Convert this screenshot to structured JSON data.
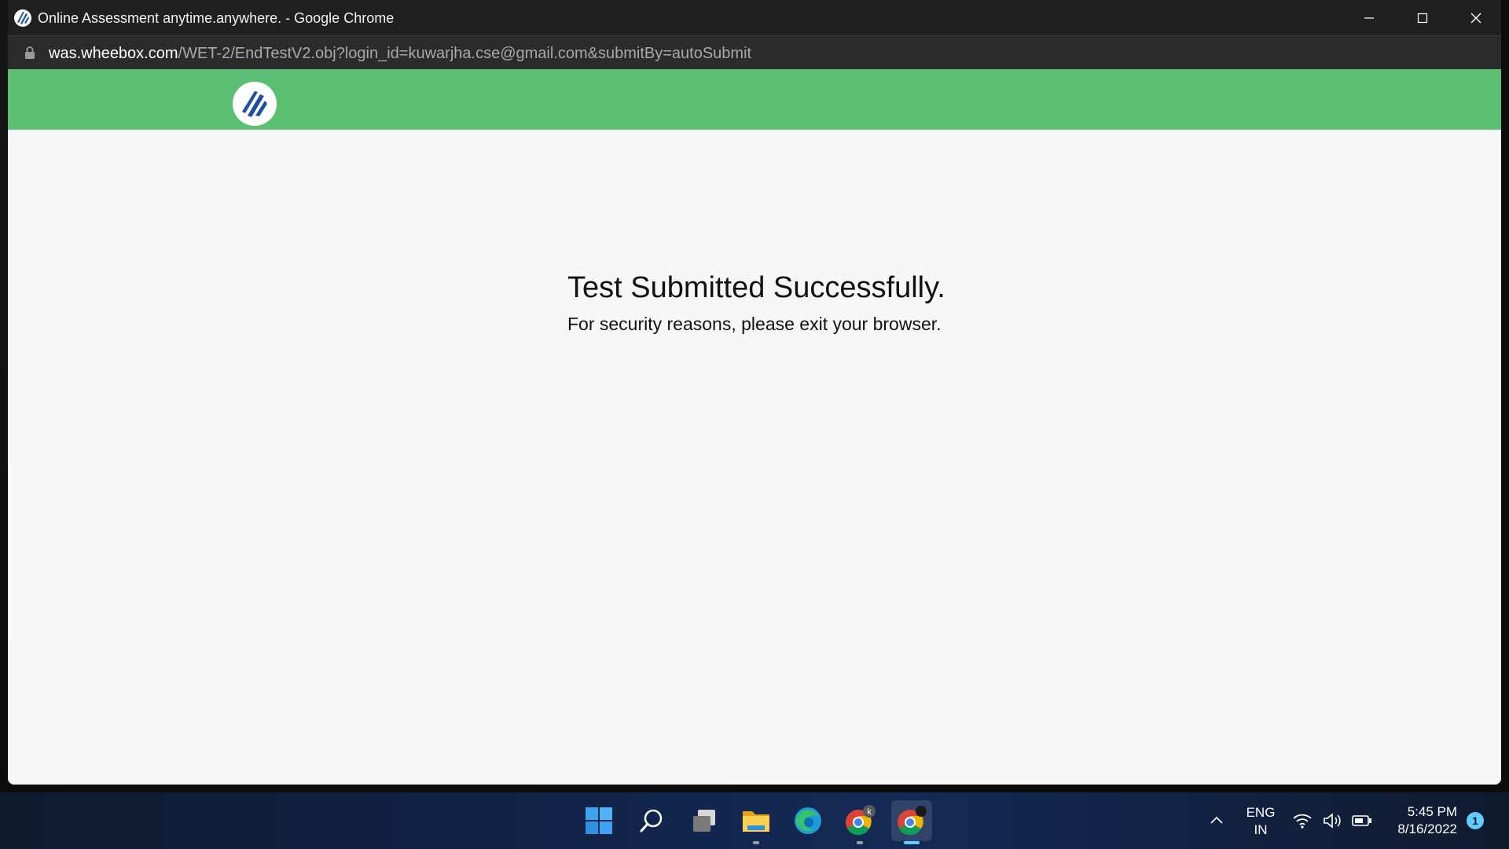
{
  "window": {
    "title": "Online Assessment anytime.anywhere. - Google Chrome"
  },
  "address_bar": {
    "domain": "was.wheebox.com",
    "path": "/WET-2/EndTestV2.obj?login_id=kuwarjha.cse@gmail.com&submitBy=autoSubmit"
  },
  "page": {
    "heading": "Test Submitted Successfully.",
    "message": "For security reasons, please exit your browser."
  },
  "taskbar": {
    "icons": [
      "start-icon",
      "search-icon",
      "task-view-icon",
      "file-explorer-icon",
      "edge-icon",
      "chrome-profile-icon",
      "chrome-icon"
    ],
    "chrome_profile_badge": "k",
    "language_line1": "ENG",
    "language_line2": "IN",
    "time": "5:45 PM",
    "date": "8/16/2022",
    "notification_count": "1"
  },
  "colors": {
    "header_green": "#5cbf74",
    "titlebar": "#202020",
    "accent": "#60cdff"
  }
}
